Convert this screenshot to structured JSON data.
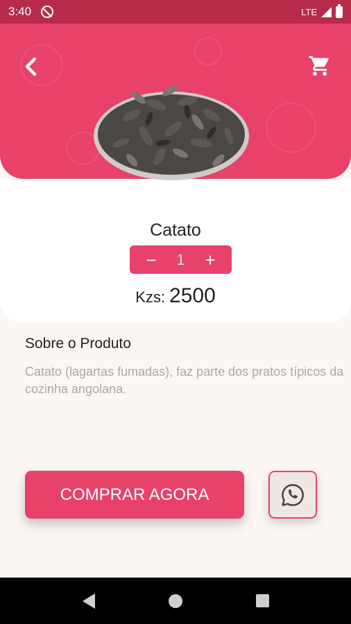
{
  "status_bar": {
    "time": "3:40",
    "network": "LTE"
  },
  "header": {
    "back_icon": "chevron-left-icon",
    "cart_icon": "shopping-cart-icon"
  },
  "product": {
    "name": "Catato",
    "quantity": "1",
    "decrement_label": "−",
    "increment_label": "+",
    "price_currency": "Kzs:",
    "price_value": "2500"
  },
  "about": {
    "title": "Sobre o Produto",
    "description": "Catato (lagartas fumadas), faz parte dos pratos típicos da cozinha angolana."
  },
  "actions": {
    "buy_label": "COMPRAR AGORA",
    "whatsapp_icon": "whatsapp-icon"
  },
  "colors": {
    "accent": "#e8416a",
    "status_bar": "#b82a4a",
    "background": "#fcf7f3"
  }
}
